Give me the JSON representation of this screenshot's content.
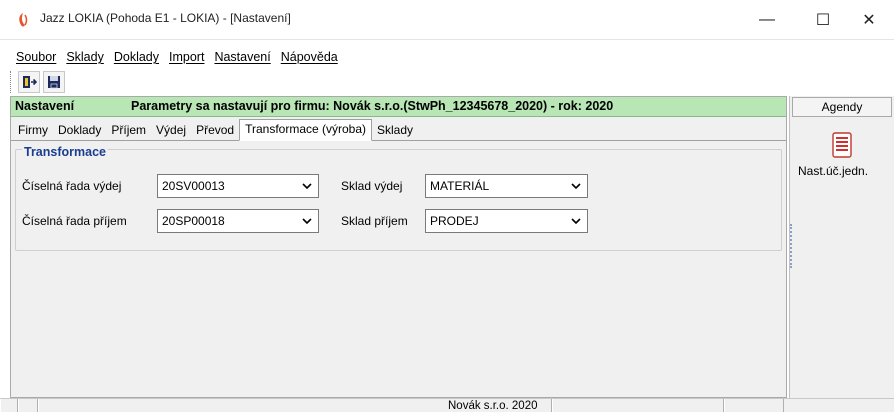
{
  "window": {
    "title": "Jazz LOKIA (Pohoda E1 - LOKIA) - [Nastavení]",
    "minimize": "—",
    "maximize": "☐",
    "close": "✕"
  },
  "menu": [
    "Soubor",
    "Sklady",
    "Doklady",
    "Import",
    "Nastavení",
    "Nápověda"
  ],
  "toolbar": {
    "icons": [
      "exit-door-icon",
      "save-floppy-icon"
    ]
  },
  "info_bar": {
    "label": "Nastavení",
    "text": "Parametry sa nastavují pro firmu: Novák s.r.o.(StwPh_12345678_2020) - rok: 2020",
    "color": "#b8e6b5"
  },
  "tabs": [
    "Firmy",
    "Doklady",
    "Příjem",
    "Výdej",
    "Převod",
    "Transformace (výroba)",
    "Sklady"
  ],
  "active_tab": "Transformace (výroba)",
  "group": {
    "title": "Transformace",
    "fields": {
      "cis_rada_vydej": {
        "label": "Číselná řada výdej",
        "value": "20SV00013"
      },
      "cis_rada_prijem": {
        "label": "Číselná řada příjem",
        "value": "20SP00018"
      },
      "sklad_vydej": {
        "label": "Sklad výdej",
        "value": "MATERIÁL"
      },
      "sklad_prijem": {
        "label": "Sklad příjem",
        "value": "PRODEJ"
      }
    }
  },
  "sidebar": {
    "header": "Agendy",
    "item": {
      "label": "Nast.úč.jedn.",
      "icon": "document-list-icon"
    }
  },
  "status": {
    "text": "Novák s.r.o. 2020"
  }
}
